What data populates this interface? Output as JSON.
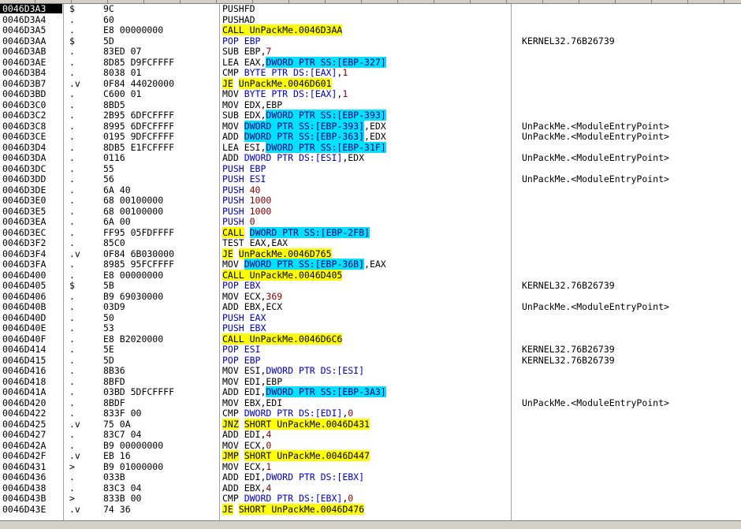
{
  "colors": {
    "call_jump_highlight": "#ffff00",
    "memory_operand_highlight": "#00e0ff",
    "selected_address_bg": "#000000"
  },
  "rows": [
    {
      "addr": "0046D3A3",
      "mark": "$",
      "hex": "9C",
      "dis": [
        {
          "t": "PUSHFD",
          "c": ""
        }
      ],
      "comment": "",
      "selected": true
    },
    {
      "addr": "0046D3A4",
      "mark": ".",
      "hex": "60",
      "dis": [
        {
          "t": "PUSHAD",
          "c": ""
        }
      ],
      "comment": ""
    },
    {
      "addr": "0046D3A5",
      "mark": ".",
      "hex": "E8 00000000",
      "dis": [
        {
          "t": "CALL UnPackMe.0046D3AA",
          "c": "y"
        }
      ],
      "comment": ""
    },
    {
      "addr": "0046D3AA",
      "mark": "$",
      "hex": "5D",
      "dis": [
        {
          "t": "POP EBP",
          "c": "b"
        }
      ],
      "comment": "KERNEL32.76B26739"
    },
    {
      "addr": "0046D3AB",
      "mark": ".",
      "hex": "83ED 07",
      "dis": [
        {
          "t": "SUB EBP,",
          "c": ""
        },
        {
          "t": "7",
          "c": "n"
        }
      ],
      "comment": ""
    },
    {
      "addr": "0046D3AE",
      "mark": ".",
      "hex": "8D85 D9FCFFFF",
      "dis": [
        {
          "t": "LEA EAX,",
          "c": ""
        },
        {
          "t": "DWORD PTR SS:[EBP-327]",
          "c": "c"
        }
      ],
      "comment": ""
    },
    {
      "addr": "0046D3B4",
      "mark": ".",
      "hex": "8038 01",
      "dis": [
        {
          "t": "CMP ",
          "c": ""
        },
        {
          "t": "BYTE PTR DS:[EAX]",
          "c": "b"
        },
        {
          "t": ",",
          "c": ""
        },
        {
          "t": "1",
          "c": "n"
        }
      ],
      "comment": ""
    },
    {
      "addr": "0046D3B7",
      "mark": ".v",
      "hex": "0F84 44020000",
      "dis": [
        {
          "t": "JE",
          "c": "y"
        },
        {
          "t": " ",
          "c": ""
        },
        {
          "t": "UnPackMe.0046D601",
          "c": "y"
        }
      ],
      "comment": ""
    },
    {
      "addr": "0046D3BD",
      "mark": ".",
      "hex": "C600 01",
      "dis": [
        {
          "t": "MOV ",
          "c": ""
        },
        {
          "t": "BYTE PTR DS:[EAX]",
          "c": "b"
        },
        {
          "t": ",",
          "c": ""
        },
        {
          "t": "1",
          "c": "n"
        }
      ],
      "comment": ""
    },
    {
      "addr": "0046D3C0",
      "mark": ".",
      "hex": "8BD5",
      "dis": [
        {
          "t": "MOV EDX,EBP",
          "c": ""
        }
      ],
      "comment": ""
    },
    {
      "addr": "0046D3C2",
      "mark": ".",
      "hex": "2B95 6DFCFFFF",
      "dis": [
        {
          "t": "SUB EDX,",
          "c": ""
        },
        {
          "t": "DWORD PTR SS:[EBP-393]",
          "c": "c"
        }
      ],
      "comment": ""
    },
    {
      "addr": "0046D3C8",
      "mark": ".",
      "hex": "8995 6DFCFFFF",
      "dis": [
        {
          "t": "MOV ",
          "c": ""
        },
        {
          "t": "DWORD PTR SS:[EBP-393]",
          "c": "c"
        },
        {
          "t": ",EDX",
          "c": ""
        }
      ],
      "comment": "UnPackMe.<ModuleEntryPoint>"
    },
    {
      "addr": "0046D3CE",
      "mark": ".",
      "hex": "0195 9DFCFFFF",
      "dis": [
        {
          "t": "ADD ",
          "c": ""
        },
        {
          "t": "DWORD PTR SS:[EBP-363]",
          "c": "c"
        },
        {
          "t": ",EDX",
          "c": ""
        }
      ],
      "comment": "UnPackMe.<ModuleEntryPoint>"
    },
    {
      "addr": "0046D3D4",
      "mark": ".",
      "hex": "8DB5 E1FCFFFF",
      "dis": [
        {
          "t": "LEA ESI,",
          "c": ""
        },
        {
          "t": "DWORD PTR SS:[EBP-31F]",
          "c": "c"
        }
      ],
      "comment": ""
    },
    {
      "addr": "0046D3DA",
      "mark": ".",
      "hex": "0116",
      "dis": [
        {
          "t": "ADD ",
          "c": ""
        },
        {
          "t": "DWORD PTR DS:[ESI]",
          "c": "b"
        },
        {
          "t": ",EDX",
          "c": ""
        }
      ],
      "comment": "UnPackMe.<ModuleEntryPoint>"
    },
    {
      "addr": "0046D3DC",
      "mark": ".",
      "hex": "55",
      "dis": [
        {
          "t": "PUSH EBP",
          "c": "b"
        }
      ],
      "comment": ""
    },
    {
      "addr": "0046D3DD",
      "mark": ".",
      "hex": "56",
      "dis": [
        {
          "t": "PUSH ESI",
          "c": "b"
        }
      ],
      "comment": "UnPackMe.<ModuleEntryPoint>"
    },
    {
      "addr": "0046D3DE",
      "mark": ".",
      "hex": "6A 40",
      "dis": [
        {
          "t": "PUSH ",
          "c": "b"
        },
        {
          "t": "40",
          "c": "n"
        }
      ],
      "comment": ""
    },
    {
      "addr": "0046D3E0",
      "mark": ".",
      "hex": "68 00100000",
      "dis": [
        {
          "t": "PUSH ",
          "c": "b"
        },
        {
          "t": "1000",
          "c": "n"
        }
      ],
      "comment": ""
    },
    {
      "addr": "0046D3E5",
      "mark": ".",
      "hex": "68 00100000",
      "dis": [
        {
          "t": "PUSH ",
          "c": "b"
        },
        {
          "t": "1000",
          "c": "n"
        }
      ],
      "comment": ""
    },
    {
      "addr": "0046D3EA",
      "mark": ".",
      "hex": "6A 00",
      "dis": [
        {
          "t": "PUSH ",
          "c": "b"
        },
        {
          "t": "0",
          "c": "n"
        }
      ],
      "comment": ""
    },
    {
      "addr": "0046D3EC",
      "mark": ".",
      "hex": "FF95 05FDFFFF",
      "dis": [
        {
          "t": "CALL",
          "c": "y"
        },
        {
          "t": " ",
          "c": ""
        },
        {
          "t": "DWORD PTR SS:[EBP-2FB]",
          "c": "c"
        }
      ],
      "comment": ""
    },
    {
      "addr": "0046D3F2",
      "mark": ".",
      "hex": "85C0",
      "dis": [
        {
          "t": "TEST EAX,EAX",
          "c": ""
        }
      ],
      "comment": ""
    },
    {
      "addr": "0046D3F4",
      "mark": ".v",
      "hex": "0F84 6B030000",
      "dis": [
        {
          "t": "JE",
          "c": "y"
        },
        {
          "t": " ",
          "c": ""
        },
        {
          "t": "UnPackMe.0046D765",
          "c": "y"
        }
      ],
      "comment": ""
    },
    {
      "addr": "0046D3FA",
      "mark": ".",
      "hex": "8985 95FCFFFF",
      "dis": [
        {
          "t": "MOV ",
          "c": ""
        },
        {
          "t": "DWORD PTR SS:[EBP-36B]",
          "c": "c"
        },
        {
          "t": ",EAX",
          "c": ""
        }
      ],
      "comment": ""
    },
    {
      "addr": "0046D400",
      "mark": ".",
      "hex": "E8 00000000",
      "dis": [
        {
          "t": "CALL UnPackMe.0046D405",
          "c": "y"
        }
      ],
      "comment": ""
    },
    {
      "addr": "0046D405",
      "mark": "$",
      "hex": "5B",
      "dis": [
        {
          "t": "POP EBX",
          "c": "b"
        }
      ],
      "comment": "KERNEL32.76B26739"
    },
    {
      "addr": "0046D406",
      "mark": ".",
      "hex": "B9 69030000",
      "dis": [
        {
          "t": "MOV ECX,",
          "c": ""
        },
        {
          "t": "369",
          "c": "n"
        }
      ],
      "comment": ""
    },
    {
      "addr": "0046D40B",
      "mark": ".",
      "hex": "03D9",
      "dis": [
        {
          "t": "ADD EBX,ECX",
          "c": ""
        }
      ],
      "comment": "UnPackMe.<ModuleEntryPoint>"
    },
    {
      "addr": "0046D40D",
      "mark": ".",
      "hex": "50",
      "dis": [
        {
          "t": "PUSH EAX",
          "c": "b"
        }
      ],
      "comment": ""
    },
    {
      "addr": "0046D40E",
      "mark": ".",
      "hex": "53",
      "dis": [
        {
          "t": "PUSH EBX",
          "c": "b"
        }
      ],
      "comment": ""
    },
    {
      "addr": "0046D40F",
      "mark": ".",
      "hex": "E8 B2020000",
      "dis": [
        {
          "t": "CALL UnPackMe.0046D6C6",
          "c": "y"
        }
      ],
      "comment": ""
    },
    {
      "addr": "0046D414",
      "mark": ".",
      "hex": "5E",
      "dis": [
        {
          "t": "POP ESI",
          "c": "b"
        }
      ],
      "comment": "KERNEL32.76B26739"
    },
    {
      "addr": "0046D415",
      "mark": ".",
      "hex": "5D",
      "dis": [
        {
          "t": "POP EBP",
          "c": "b"
        }
      ],
      "comment": "KERNEL32.76B26739"
    },
    {
      "addr": "0046D416",
      "mark": ".",
      "hex": "8B36",
      "dis": [
        {
          "t": "MOV ESI,",
          "c": ""
        },
        {
          "t": "DWORD PTR DS:[ESI]",
          "c": "b"
        }
      ],
      "comment": ""
    },
    {
      "addr": "0046D418",
      "mark": ".",
      "hex": "8BFD",
      "dis": [
        {
          "t": "MOV EDI,EBP",
          "c": ""
        }
      ],
      "comment": ""
    },
    {
      "addr": "0046D41A",
      "mark": ".",
      "hex": "03BD 5DFCFFFF",
      "dis": [
        {
          "t": "ADD EDI,",
          "c": ""
        },
        {
          "t": "DWORD PTR SS:[EBP-3A3]",
          "c": "c"
        }
      ],
      "comment": ""
    },
    {
      "addr": "0046D420",
      "mark": ".",
      "hex": "8BDF",
      "dis": [
        {
          "t": "MOV EBX,EDI",
          "c": ""
        }
      ],
      "comment": "UnPackMe.<ModuleEntryPoint>"
    },
    {
      "addr": "0046D422",
      "mark": ".",
      "hex": "833F 00",
      "dis": [
        {
          "t": "CMP ",
          "c": ""
        },
        {
          "t": "DWORD PTR DS:[EDI]",
          "c": "b"
        },
        {
          "t": ",",
          "c": ""
        },
        {
          "t": "0",
          "c": "n"
        }
      ],
      "comment": ""
    },
    {
      "addr": "0046D425",
      "mark": ".v",
      "hex": "75 0A",
      "dis": [
        {
          "t": "JNZ",
          "c": "y"
        },
        {
          "t": " ",
          "c": ""
        },
        {
          "t": "SHORT UnPackMe.0046D431",
          "c": "y"
        }
      ],
      "comment": ""
    },
    {
      "addr": "0046D427",
      "mark": ".",
      "hex": "83C7 04",
      "dis": [
        {
          "t": "ADD EDI,",
          "c": ""
        },
        {
          "t": "4",
          "c": "n"
        }
      ],
      "comment": ""
    },
    {
      "addr": "0046D42A",
      "mark": ".",
      "hex": "B9 00000000",
      "dis": [
        {
          "t": "MOV ECX,",
          "c": ""
        },
        {
          "t": "0",
          "c": "n"
        }
      ],
      "comment": ""
    },
    {
      "addr": "0046D42F",
      "mark": ".v",
      "hex": "EB 16",
      "dis": [
        {
          "t": "JMP",
          "c": "y"
        },
        {
          "t": " ",
          "c": ""
        },
        {
          "t": "SHORT UnPackMe.0046D447",
          "c": "y"
        }
      ],
      "comment": ""
    },
    {
      "addr": "0046D431",
      "mark": ">",
      "hex": "B9 01000000",
      "dis": [
        {
          "t": "MOV ECX,",
          "c": ""
        },
        {
          "t": "1",
          "c": "n"
        }
      ],
      "comment": ""
    },
    {
      "addr": "0046D436",
      "mark": ".",
      "hex": "033B",
      "dis": [
        {
          "t": "ADD EDI,",
          "c": ""
        },
        {
          "t": "DWORD PTR DS:[EBX]",
          "c": "b"
        }
      ],
      "comment": ""
    },
    {
      "addr": "0046D438",
      "mark": ".",
      "hex": "83C3 04",
      "dis": [
        {
          "t": "ADD EBX,",
          "c": ""
        },
        {
          "t": "4",
          "c": "n"
        }
      ],
      "comment": ""
    },
    {
      "addr": "0046D43B",
      "mark": ">",
      "hex": "833B 00",
      "dis": [
        {
          "t": "CMP ",
          "c": ""
        },
        {
          "t": "DWORD PTR DS:[EBX]",
          "c": "b"
        },
        {
          "t": ",",
          "c": ""
        },
        {
          "t": "0",
          "c": "n"
        }
      ],
      "comment": ""
    },
    {
      "addr": "0046D43E",
      "mark": ".v",
      "hex": "74 36",
      "dis": [
        {
          "t": "JE",
          "c": "y"
        },
        {
          "t": " ",
          "c": ""
        },
        {
          "t": "SHORT UnPackMe.0046D476",
          "c": "y"
        }
      ],
      "comment": ""
    }
  ]
}
